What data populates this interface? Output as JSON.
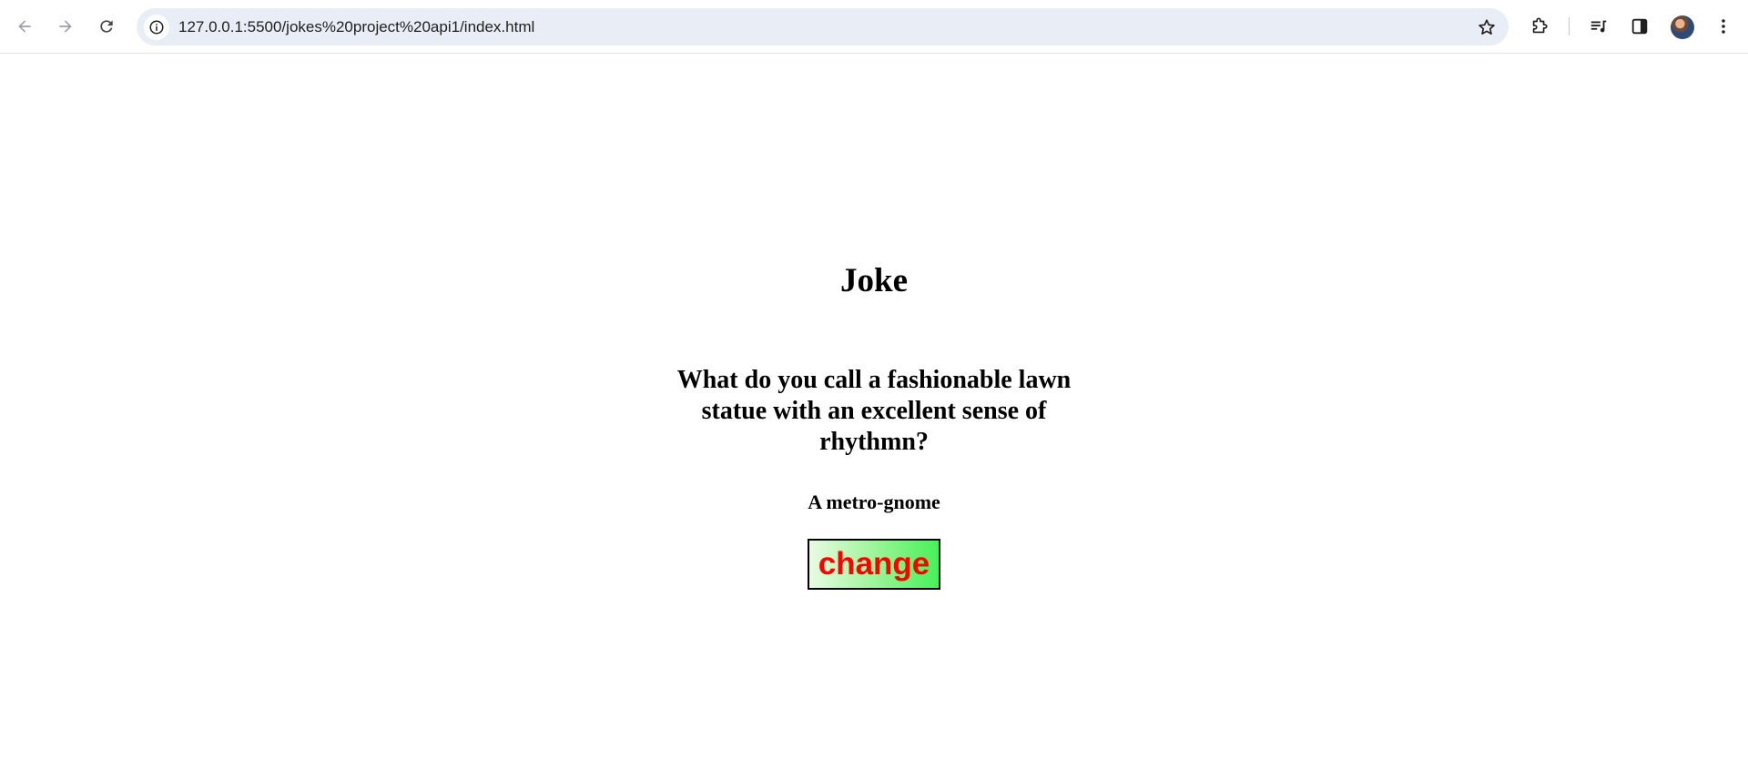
{
  "browser": {
    "url": "127.0.0.1:5500/jokes%20project%20api1/index.html",
    "icons": {
      "back": "arrow-left",
      "forward": "arrow-right",
      "reload": "reload",
      "site_info": "info-circle",
      "bookmark": "star-outline",
      "extensions": "puzzle-piece",
      "media": "queue-music",
      "side_panel": "side-panel",
      "profile": "avatar",
      "menu": "vertical-dots"
    }
  },
  "page": {
    "title": "Joke",
    "setup": "What do you call a fashionable lawn statue with an excellent sense of rhythmn?",
    "punchline": "A metro-gnome",
    "change_label": "change"
  },
  "colors": {
    "button_text": "#ff0000",
    "button_gradient_start": "#e9fbe2",
    "button_gradient_end": "#46f15a",
    "omnibox_bg": "#e9edf6"
  }
}
